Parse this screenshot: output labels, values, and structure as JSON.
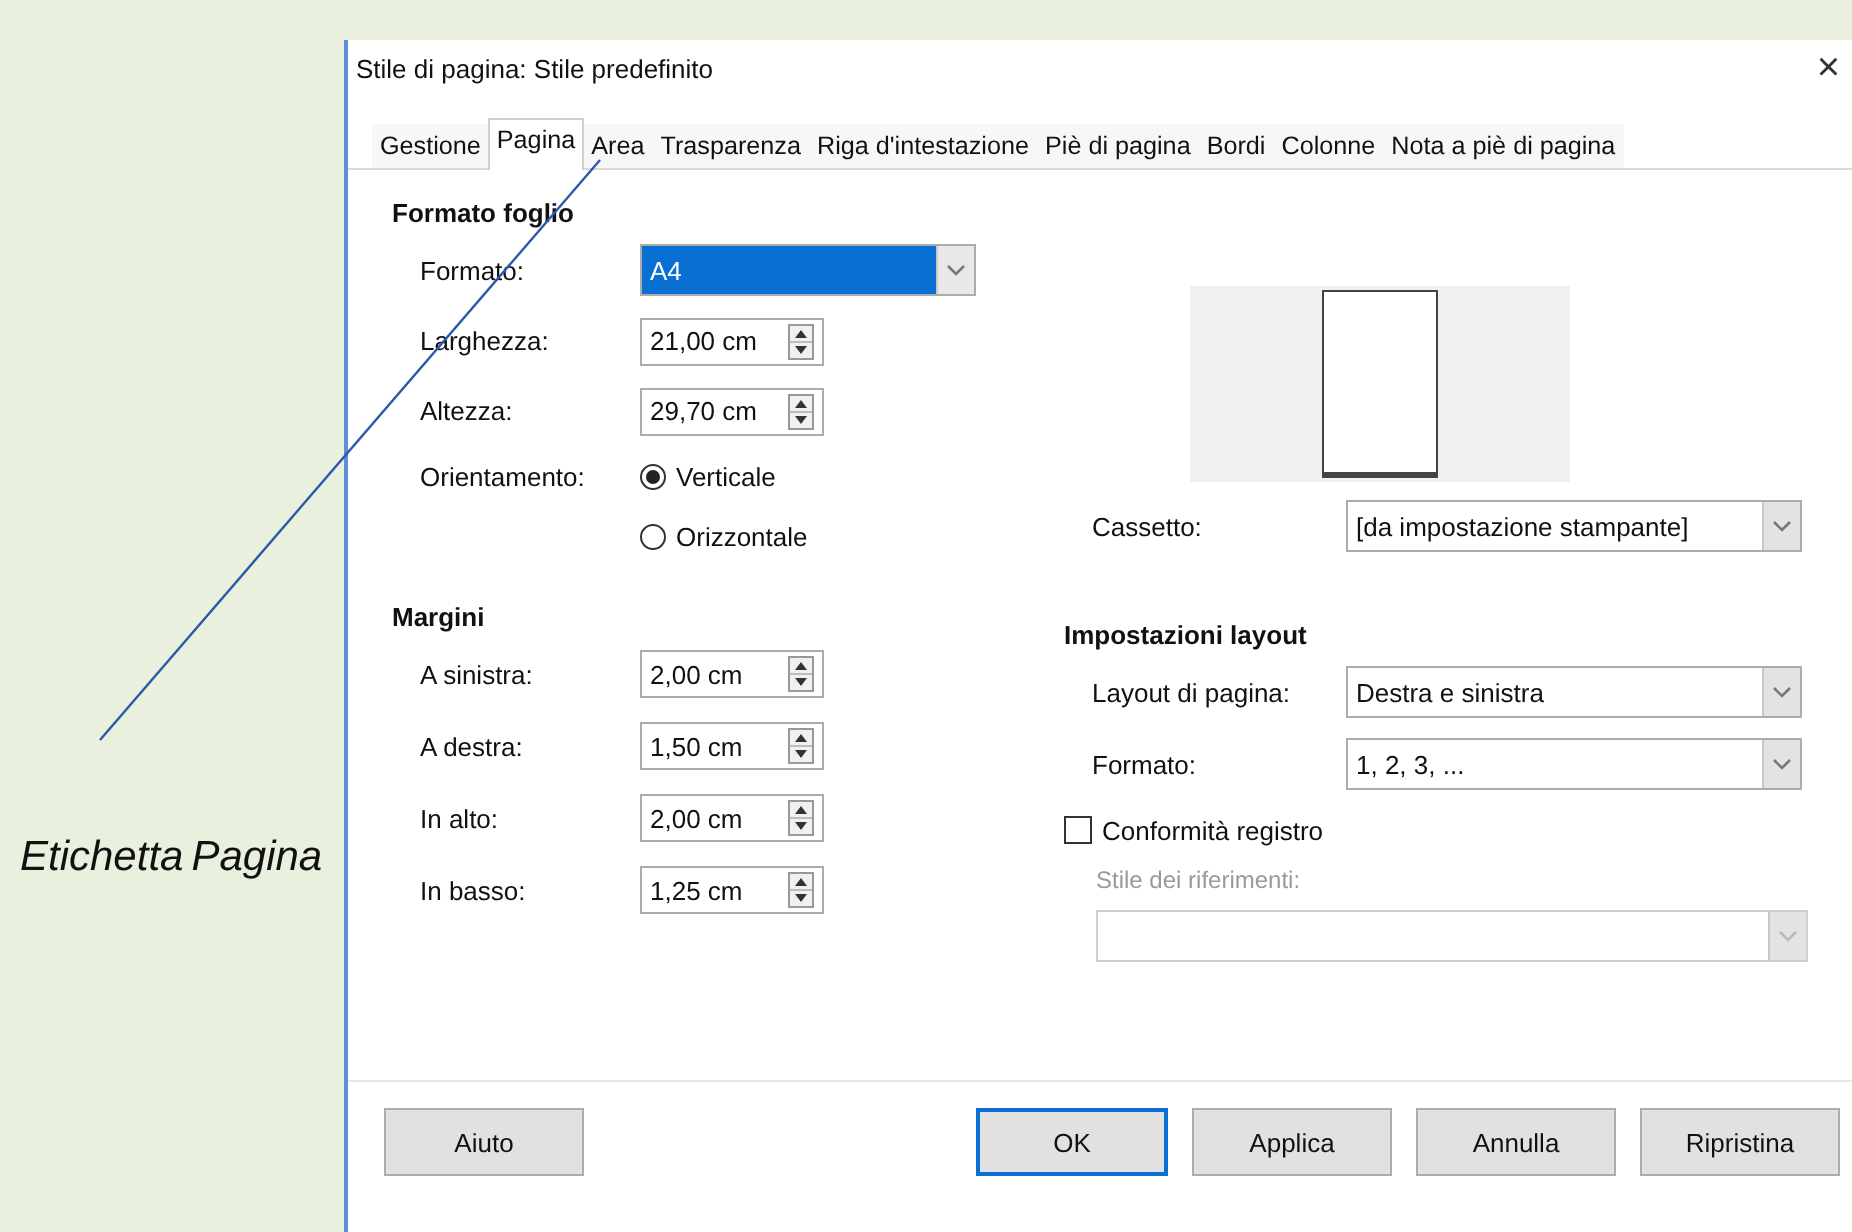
{
  "window": {
    "title": "Stile di pagina: Stile predefinito",
    "close": "×"
  },
  "tabs": [
    {
      "label": "Gestione",
      "selected": false
    },
    {
      "label": "Pagina",
      "selected": true
    },
    {
      "label": "Area",
      "selected": false
    },
    {
      "label": "Trasparenza",
      "selected": false
    },
    {
      "label": "Riga d'intestazione",
      "selected": false
    },
    {
      "label": "Piè di pagina",
      "selected": false
    },
    {
      "label": "Bordi",
      "selected": false
    },
    {
      "label": "Colonne",
      "selected": false
    },
    {
      "label": "Nota a piè di pagina",
      "selected": false
    }
  ],
  "paper_format": {
    "heading": "Formato foglio",
    "format": {
      "label": "Formato:",
      "value": "A4",
      "highlighted": true
    },
    "width": {
      "label": "Larghezza:",
      "value": "21,00 cm"
    },
    "height": {
      "label": "Altezza:",
      "value": "29,70 cm"
    },
    "orientation": {
      "label": "Orientamento:",
      "options": [
        {
          "label": "Verticale",
          "selected": true
        },
        {
          "label": "Orizzontale",
          "selected": false
        }
      ]
    }
  },
  "tray": {
    "label": "Cassetto:",
    "value": "[da impostazione stampante]"
  },
  "margins": {
    "heading": "Margini",
    "fields": [
      {
        "label": "A sinistra:",
        "value": "2,00 cm"
      },
      {
        "label": "A destra:",
        "value": "1,50 cm"
      },
      {
        "label": "In alto:",
        "value": "2,00 cm"
      },
      {
        "label": "In basso:",
        "value": "1,25 cm"
      }
    ]
  },
  "layout_settings": {
    "heading": "Impostazioni layout",
    "page_layout": {
      "label": "Layout di pagina:",
      "value": "Destra e sinistra"
    },
    "format": {
      "label": "Formato:",
      "value": "1, 2, 3, ..."
    },
    "register_true": {
      "label": "Conformità registro",
      "checked": false
    },
    "reference_style": {
      "label": "Stile dei riferimenti:",
      "disabled": true
    }
  },
  "buttons": [
    {
      "label": "Aiuto",
      "default": false
    },
    {
      "label": "OK",
      "default": true
    },
    {
      "label": "Applica",
      "default": false
    },
    {
      "label": "Annulla",
      "default": false
    },
    {
      "label": "Ripristina",
      "default": false
    }
  ],
  "callout": {
    "labels": [
      "Etichetta",
      "Pagina"
    ]
  }
}
